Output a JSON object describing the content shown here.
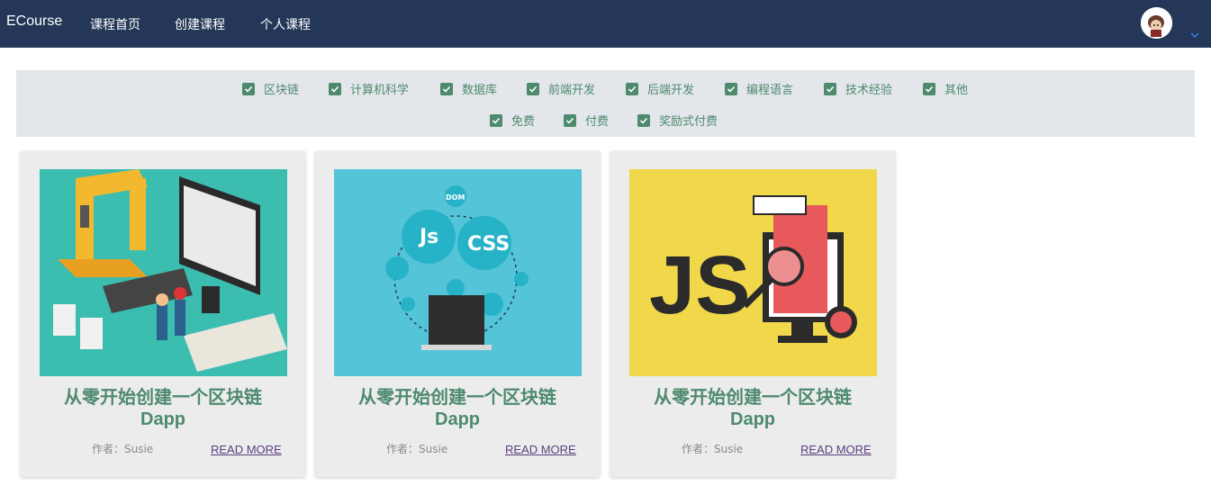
{
  "header": {
    "brand": "ECourse",
    "nav": [
      "课程首页",
      "创建课程",
      "个人课程"
    ]
  },
  "filters": {
    "categories": [
      "区块链",
      "计算机科学",
      "数据库",
      "前端开发",
      "后端开发",
      "编程语言",
      "技术经验",
      "其他"
    ],
    "pricing": [
      "免费",
      "付费",
      "奖励式付费"
    ]
  },
  "courses": [
    {
      "title_line1": "从零开始创建一个区块链",
      "title_line2": "Dapp",
      "author": "作者：Susie",
      "more": "READ MORE",
      "image_icon": "blockchain-factory-illustration",
      "bg": "#3bbdb0"
    },
    {
      "title_line1": "从零开始创建一个区块链",
      "title_line2": "Dapp",
      "author": "作者：Susie",
      "more": "READ MORE",
      "image_icon": "js-css-dom-illustration",
      "bg": "#54c4d8"
    },
    {
      "title_line1": "从零开始创建一个区块链",
      "title_line2": "Dapp",
      "author": "作者：Susie",
      "more": "READ MORE",
      "image_icon": "js-debug-illustration",
      "bg": "#f1d84a"
    }
  ],
  "colors": {
    "accent": "#4d8a6e",
    "header": "#253758",
    "link": "#5a3d80"
  }
}
